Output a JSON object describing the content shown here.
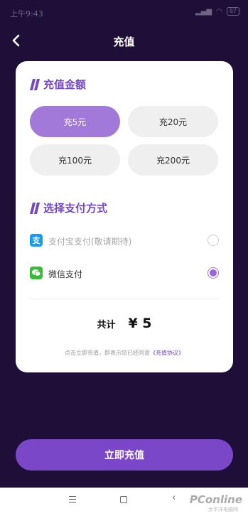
{
  "status_bar": {
    "time": "上午9:43",
    "battery": "87"
  },
  "header": {
    "title": "充值"
  },
  "amount_section": {
    "title": "充值金额",
    "options": [
      {
        "label": "充5元",
        "selected": true
      },
      {
        "label": "充20元",
        "selected": false
      },
      {
        "label": "充100元",
        "selected": false
      },
      {
        "label": "充200元",
        "selected": false
      }
    ]
  },
  "payment_section": {
    "title": "选择支付方式",
    "methods": [
      {
        "label": "支付宝支付(敬请期待)",
        "icon": "alipay-icon",
        "icon_glyph": "支",
        "icon_color": "#1a9bf2",
        "disabled": true,
        "selected": false
      },
      {
        "label": "微信支付",
        "icon": "wechat-icon",
        "icon_color": "#3aba3a",
        "disabled": false,
        "selected": true
      }
    ]
  },
  "summary": {
    "total_label": "共计",
    "total_value": "¥ 5"
  },
  "agreement": {
    "text": "点击立即充值，即表示您已经同意",
    "link": "《充值协议》"
  },
  "primary_button": {
    "label": "立即充值"
  },
  "watermark": {
    "brand": "PConline",
    "sub": "太平洋电脑网"
  },
  "colors": {
    "accent": "#7a47c8",
    "selected_option": "#a278d8",
    "background": "#1f0e38"
  }
}
